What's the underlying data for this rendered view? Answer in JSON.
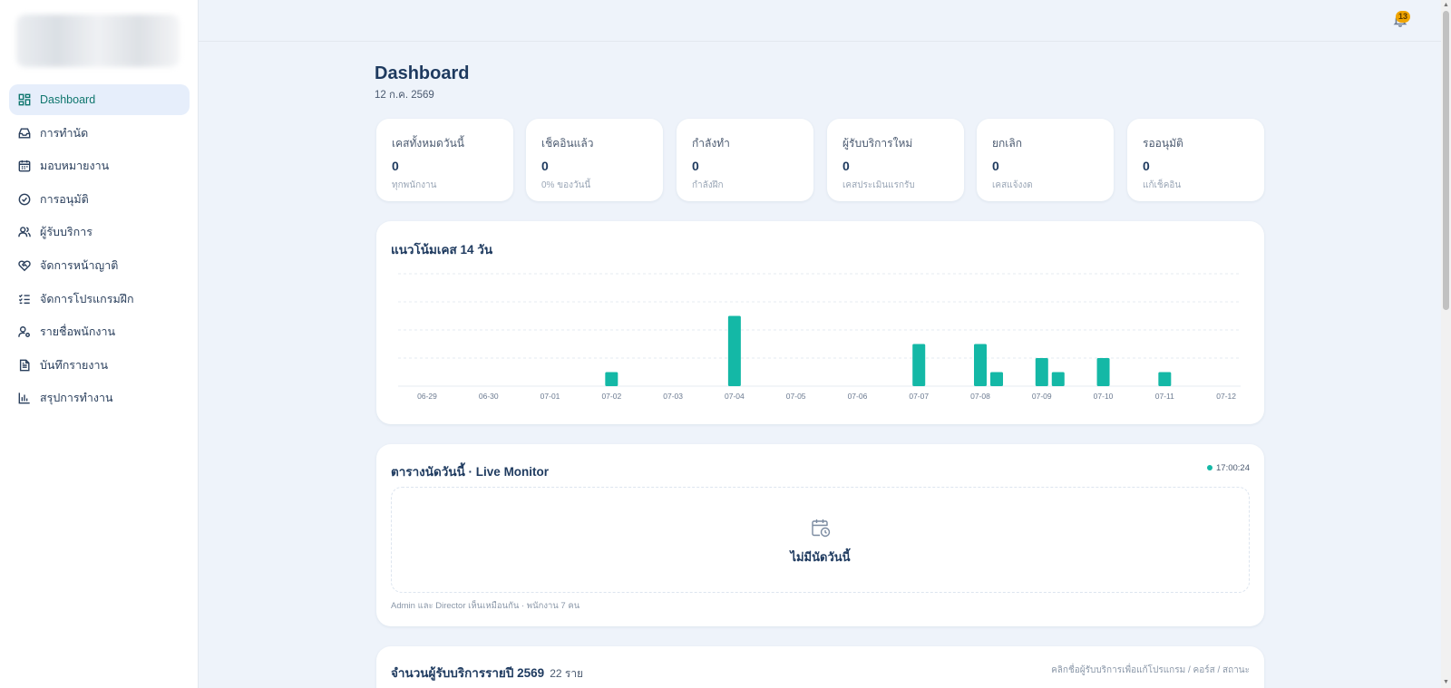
{
  "sidebar": {
    "items": [
      {
        "label": "Dashboard",
        "icon": "grid-icon",
        "active": true
      },
      {
        "label": "การทำนัด",
        "icon": "inbox-icon"
      },
      {
        "label": "มอบหมายงาน",
        "icon": "calendar-icon"
      },
      {
        "label": "การอนุมัติ",
        "icon": "check-circle-icon"
      },
      {
        "label": "ผู้รับบริการ",
        "icon": "users-icon"
      },
      {
        "label": "จัดการหน้าญาติ",
        "icon": "heart-handshake-icon"
      },
      {
        "label": "จัดการโปรแกรมฝึก",
        "icon": "list-checks-icon"
      },
      {
        "label": "รายชื่อพนักงาน",
        "icon": "user-cog-icon"
      },
      {
        "label": "บันทึกรายงาน",
        "icon": "file-text-icon"
      },
      {
        "label": "สรุปการทำงาน",
        "icon": "bar-chart-icon"
      }
    ]
  },
  "topbar": {
    "notification_count": "13"
  },
  "page": {
    "title": "Dashboard",
    "date": "12 ก.ค. 2569"
  },
  "stats": [
    {
      "label": "เคสทั้งหมดวันนี้",
      "value": "0",
      "sub": "ทุกพนักงาน"
    },
    {
      "label": "เช็คอินแล้ว",
      "value": "0",
      "sub": "0% ของวันนี้"
    },
    {
      "label": "กำลังทำ",
      "value": "0",
      "sub": "กำลังฝึก"
    },
    {
      "label": "ผู้รับบริการใหม่",
      "value": "0",
      "sub": "เคสประเมินแรกรับ"
    },
    {
      "label": "ยกเลิก",
      "value": "0",
      "sub": "เคสแจ้งงด"
    },
    {
      "label": "รออนุมัติ",
      "value": "0",
      "sub": "แก้เช็คอิน"
    }
  ],
  "trend": {
    "title": "แนวโน้มเคส 14 วัน"
  },
  "chart_data": {
    "type": "bar",
    "title": "แนวโน้มเคส 14 วัน",
    "categories": [
      "06-29",
      "06-30",
      "07-01",
      "07-02",
      "07-03",
      "07-04",
      "07-05",
      "07-06",
      "07-07",
      "07-08",
      "07-09",
      "07-10",
      "07-11",
      "07-12"
    ],
    "series": [
      {
        "values": [
          0,
          0,
          0,
          1,
          0,
          5,
          0,
          0,
          3,
          3,
          2,
          2,
          1,
          0
        ],
        "color": "#14b8a6"
      },
      {
        "values": [
          0,
          0,
          0,
          0,
          0,
          0,
          0,
          0,
          0,
          1,
          1,
          0,
          0,
          0
        ],
        "color": "#14b8a6"
      }
    ],
    "ylim": [
      0,
      8
    ],
    "grid": true
  },
  "live": {
    "title": "ตารางนัดวันนี้ · Live Monitor",
    "time": "17:00:24",
    "empty_text": "ไม่มีนัดวันนี้",
    "footnote": "Admin และ Director เห็นเหมือนกัน · พนักงาน 7 คน"
  },
  "yearly": {
    "title": "จำนวนผู้รับบริการรายปี 2569",
    "count": "22 ราย",
    "hint": "คลิกชื่อผู้รับบริการเพื่อแก้โปรแกรม / คอร์ส / สถานะ"
  },
  "colors": {
    "accent": "#14b8a6",
    "active_nav_bg": "#e6eefb",
    "active_nav_text": "#0f766e",
    "page_bg": "#eef3fa"
  }
}
